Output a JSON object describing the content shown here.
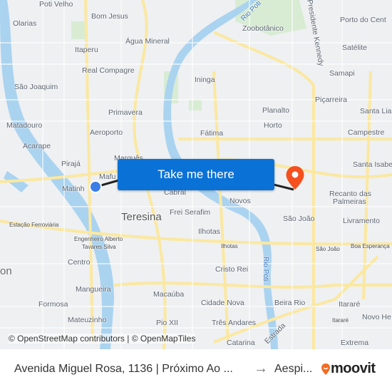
{
  "map": {
    "labels": [
      "Poti Velho",
      "Olarias",
      "Bom Jesus",
      "Rio Poti",
      "Zoobotânico",
      "Presidente Kennedy",
      "Porto do Cent",
      "Água Mineral",
      "Itaperu",
      "Satélite",
      "Real Compagre",
      "Samapi",
      "Ininga",
      "São Joaquim",
      "Planalto",
      "Piçarreira",
      "Primavera",
      "Santa Lia",
      "Matadouro",
      "Horto",
      "Aeroporto",
      "Fátima",
      "Campestre",
      "Acarape",
      "Marquês",
      "Pirajá",
      "Santa Isabel",
      "Mafu",
      "Matinh",
      "Cabral",
      "Recanto das",
      "Palmeiras",
      "Novos",
      "Teresina",
      "Frei Serafim",
      "São João",
      "Livramento",
      "Estação Ferroviária",
      "Ilhotas",
      "Engenheiro Alberto",
      "Tavares Silva",
      "Ilhotas",
      "São João",
      "Boa Esperança",
      "on",
      "Centro",
      "Cristo Rei",
      "Rio Poti",
      "Mangueira",
      "Itararé",
      "Formosa",
      "Macaúba",
      "Cidade Nova",
      "Beira Rio",
      "Mateuzinho",
      "Novo He",
      "Itararé",
      "Pio XII",
      "Três Andares",
      "Estrada",
      "Catarina",
      "Extrema"
    ],
    "attribution": "© OpenStreetMap contributors | © OpenMapTiles",
    "route_color": "#222222",
    "origin_color": "#3b7ee8",
    "destination_color": "#f4511e",
    "origin_icon": "origin-dot-icon",
    "destination_icon": "map-pin-icon"
  },
  "cta": {
    "label": "Take me there",
    "color": "#0a72d6"
  },
  "footer": {
    "from": "Avenida Miguel Rosa, 1136 | Próximo Ao ...",
    "arrow_icon": "arrow-right-icon",
    "to": "Aespi...",
    "brand": "moovit",
    "brand_color": "#f26b21"
  }
}
